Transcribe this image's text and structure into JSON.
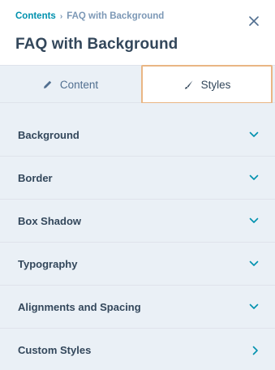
{
  "header": {
    "breadcrumb": {
      "root": "Contents",
      "separator": "›",
      "current": "FAQ with Background"
    },
    "title": "FAQ with Background",
    "close_icon": "close-icon"
  },
  "tabs": [
    {
      "label": "Content",
      "icon": "pencil-icon",
      "active": false
    },
    {
      "label": "Styles",
      "icon": "brush-icon",
      "active": true
    }
  ],
  "sections": [
    {
      "label": "Background",
      "icon": "chevron-down-icon"
    },
    {
      "label": "Border",
      "icon": "chevron-down-icon"
    },
    {
      "label": "Box Shadow",
      "icon": "chevron-down-icon"
    },
    {
      "label": "Typography",
      "icon": "chevron-down-icon"
    },
    {
      "label": "Alignments and Spacing",
      "icon": "chevron-down-icon"
    },
    {
      "label": "Custom Styles",
      "icon": "chevron-right-icon"
    }
  ],
  "colors": {
    "link": "#0091ae",
    "text": "#33475b",
    "muted": "#7c98b6",
    "panel_bg": "#eaf0f6",
    "highlight_border": "#e9b684"
  }
}
